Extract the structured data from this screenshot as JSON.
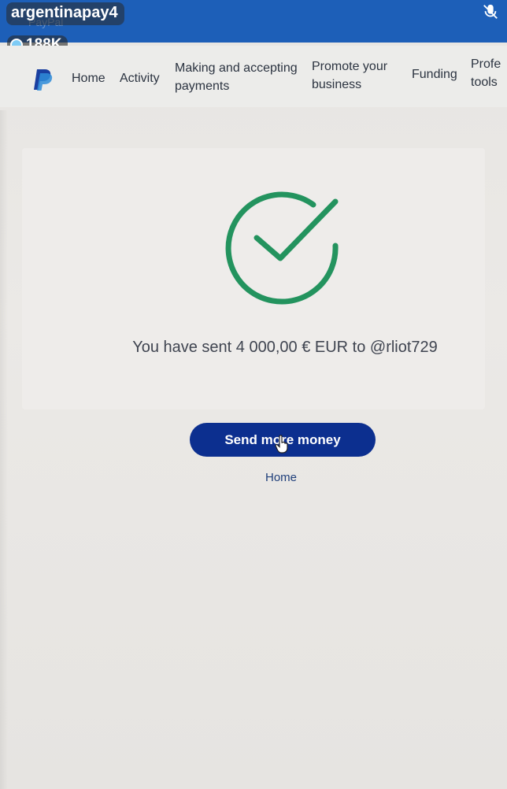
{
  "window": {
    "title": "PayPal"
  },
  "overlay": {
    "username": "argentinapay4",
    "viewers": "188K"
  },
  "nav": {
    "logo_icon": "paypal-logo-icon",
    "items": [
      {
        "label": "Home"
      },
      {
        "label": "Activity"
      },
      {
        "label": "Making and accepting payments"
      },
      {
        "label": "Promote your business"
      },
      {
        "label": "Funding"
      },
      {
        "label": "Profe tools"
      }
    ]
  },
  "confirmation": {
    "icon": "check-circle-icon",
    "message": "You have sent 4 000,00 € EUR to @rliot729",
    "primary_button": "Send more money",
    "secondary_link": "Home"
  },
  "colors": {
    "top_bar": "#1d5fb8",
    "success_green": "#23935e",
    "button_blue": "#0c2f8f",
    "text_dark": "#3f4450"
  }
}
